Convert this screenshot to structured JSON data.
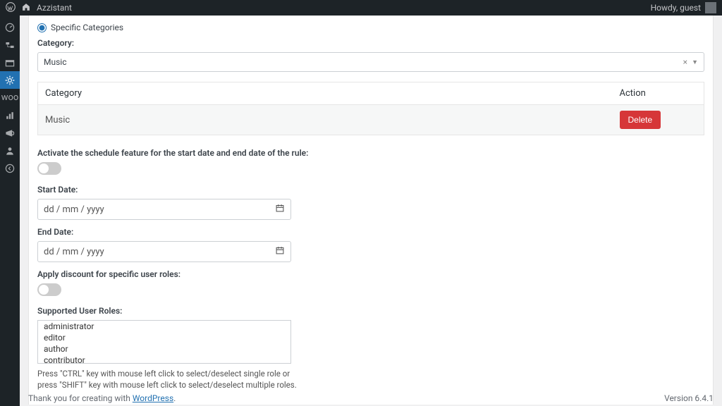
{
  "adminbar": {
    "site_name": "Azzistant",
    "howdy": "Howdy, guest"
  },
  "radio": {
    "specific_categories": "Specific Categories"
  },
  "category": {
    "label": "Category:",
    "selected": "Music",
    "table": {
      "col_category": "Category",
      "col_action": "Action",
      "row_name": "Music",
      "delete": "Delete"
    }
  },
  "schedule": {
    "activate_label": "Activate the schedule feature for the start date and end date of the rule:",
    "start_label": "Start Date:",
    "end_label": "End Date:",
    "placeholder": "dd / mm / yyyy"
  },
  "user_roles": {
    "apply_label": "Apply discount for specific user roles:",
    "supported_label": "Supported User Roles:",
    "options": [
      "administrator",
      "editor",
      "author",
      "contributor"
    ],
    "hint": "Press \"CTRL\" key with mouse left click to select/deselect single role or press \"SHIFT\" key with mouse left click to select/deselect multiple roles."
  },
  "footer": {
    "thanks_prefix": "Thank you for creating with ",
    "wp": "WordPress",
    "version": "Version 6.4.1"
  }
}
